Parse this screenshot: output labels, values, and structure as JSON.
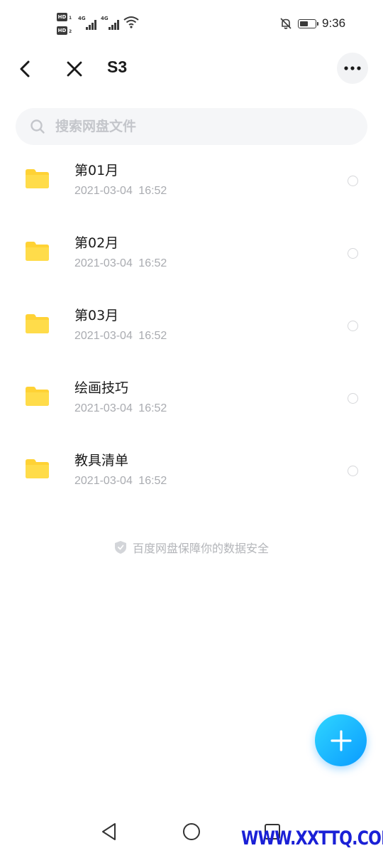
{
  "status_bar": {
    "hd1": "HD",
    "hd1_sub": "1",
    "hd2": "HD",
    "hd2_sub": "2",
    "network1": "4G",
    "network2": "4G",
    "battery_level": 0.6,
    "time": "9:36"
  },
  "header": {
    "title": "S3"
  },
  "search": {
    "placeholder": "搜索网盘文件"
  },
  "files": [
    {
      "name": "第01月",
      "date": "2021-03-04",
      "time": "16:52"
    },
    {
      "name": "第02月",
      "date": "2021-03-04",
      "time": "16:52"
    },
    {
      "name": "第03月",
      "date": "2021-03-04",
      "time": "16:52"
    },
    {
      "name": "绘画技巧",
      "date": "2021-03-04",
      "time": "16:52"
    },
    {
      "name": "教具清单",
      "date": "2021-03-04",
      "time": "16:52"
    }
  ],
  "footer": {
    "security_note": "百度网盘保障你的数据安全"
  },
  "watermark": "WWW.XXTTQ.COM",
  "colors": {
    "accent": "#0a9bff",
    "folder": "#ffd235",
    "watermark": "#1a20d6"
  }
}
